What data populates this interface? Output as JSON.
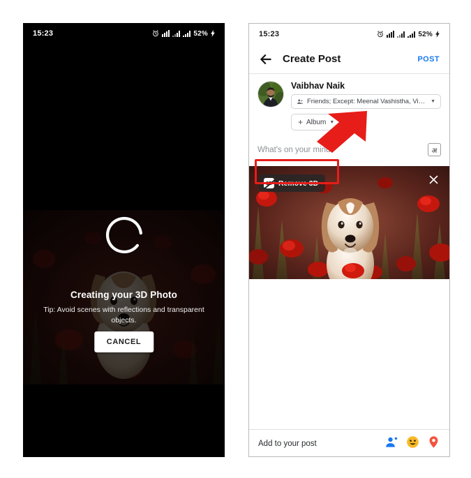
{
  "status_bar": {
    "time": "15:23",
    "battery_percent": "52%",
    "icons": [
      "alarm-icon",
      "sim-signal-icon",
      "signal-bars-icon",
      "wifi-signal-icon",
      "charging-bolt-icon"
    ]
  },
  "left_screen": {
    "name": "3d-photo-creation-overlay",
    "title": "Creating your 3D Photo",
    "tip": "Tip: Avoid scenes with reflections and transparent objects.",
    "cancel_label": "CANCEL",
    "spinner": "loading-spinner",
    "background": "dog-in-poppy-field-photo"
  },
  "right_screen": {
    "name": "create-post-screen",
    "header": {
      "back_icon": "back-arrow-icon",
      "title": "Create Post",
      "post_label": "POST"
    },
    "user": {
      "name": "Vaibhav Naik",
      "avatar": "user-avatar",
      "audience": "Friends; Except: Meenal Vashistha, Vinay Kum...",
      "audience_icon": "friends-icon",
      "album_label": "Album",
      "album_plus": "+"
    },
    "composer": {
      "placeholder": "What's on your mind?",
      "language_key": "अ"
    },
    "photo": {
      "remove_3d_label": "Remove 3D",
      "remove_3d_icon": "remove-3d-icon",
      "close_icon": "close-icon",
      "image": "dog-in-poppy-field-photo"
    },
    "footer": {
      "label": "Add to your post",
      "icons": [
        {
          "name": "tag-people-icon",
          "color": "#1877f2"
        },
        {
          "name": "feeling-activity-icon",
          "color": "#f7b928"
        },
        {
          "name": "check-in-location-icon",
          "color": "#f5533d"
        }
      ]
    }
  },
  "annotations": {
    "highlight_color": "#e71d19",
    "arrow": "red-arrow-pointing-to-remove-3d",
    "rect": "red-rectangle-around-remove-3d"
  }
}
